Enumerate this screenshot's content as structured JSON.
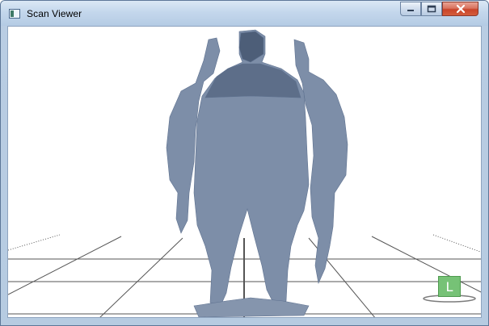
{
  "window": {
    "title": "Scan Viewer",
    "icon": "app-window-icon"
  },
  "controls": {
    "minimize_icon": "minimize-icon",
    "maximize_icon": "maximize-icon",
    "close_icon": "close-icon"
  },
  "viewport": {
    "background": "#ffffff",
    "grid_color": "#555555",
    "scan_color": "#7d8ea8",
    "orientation_badge_label": "L",
    "orientation_badge_color": "#76c276"
  }
}
